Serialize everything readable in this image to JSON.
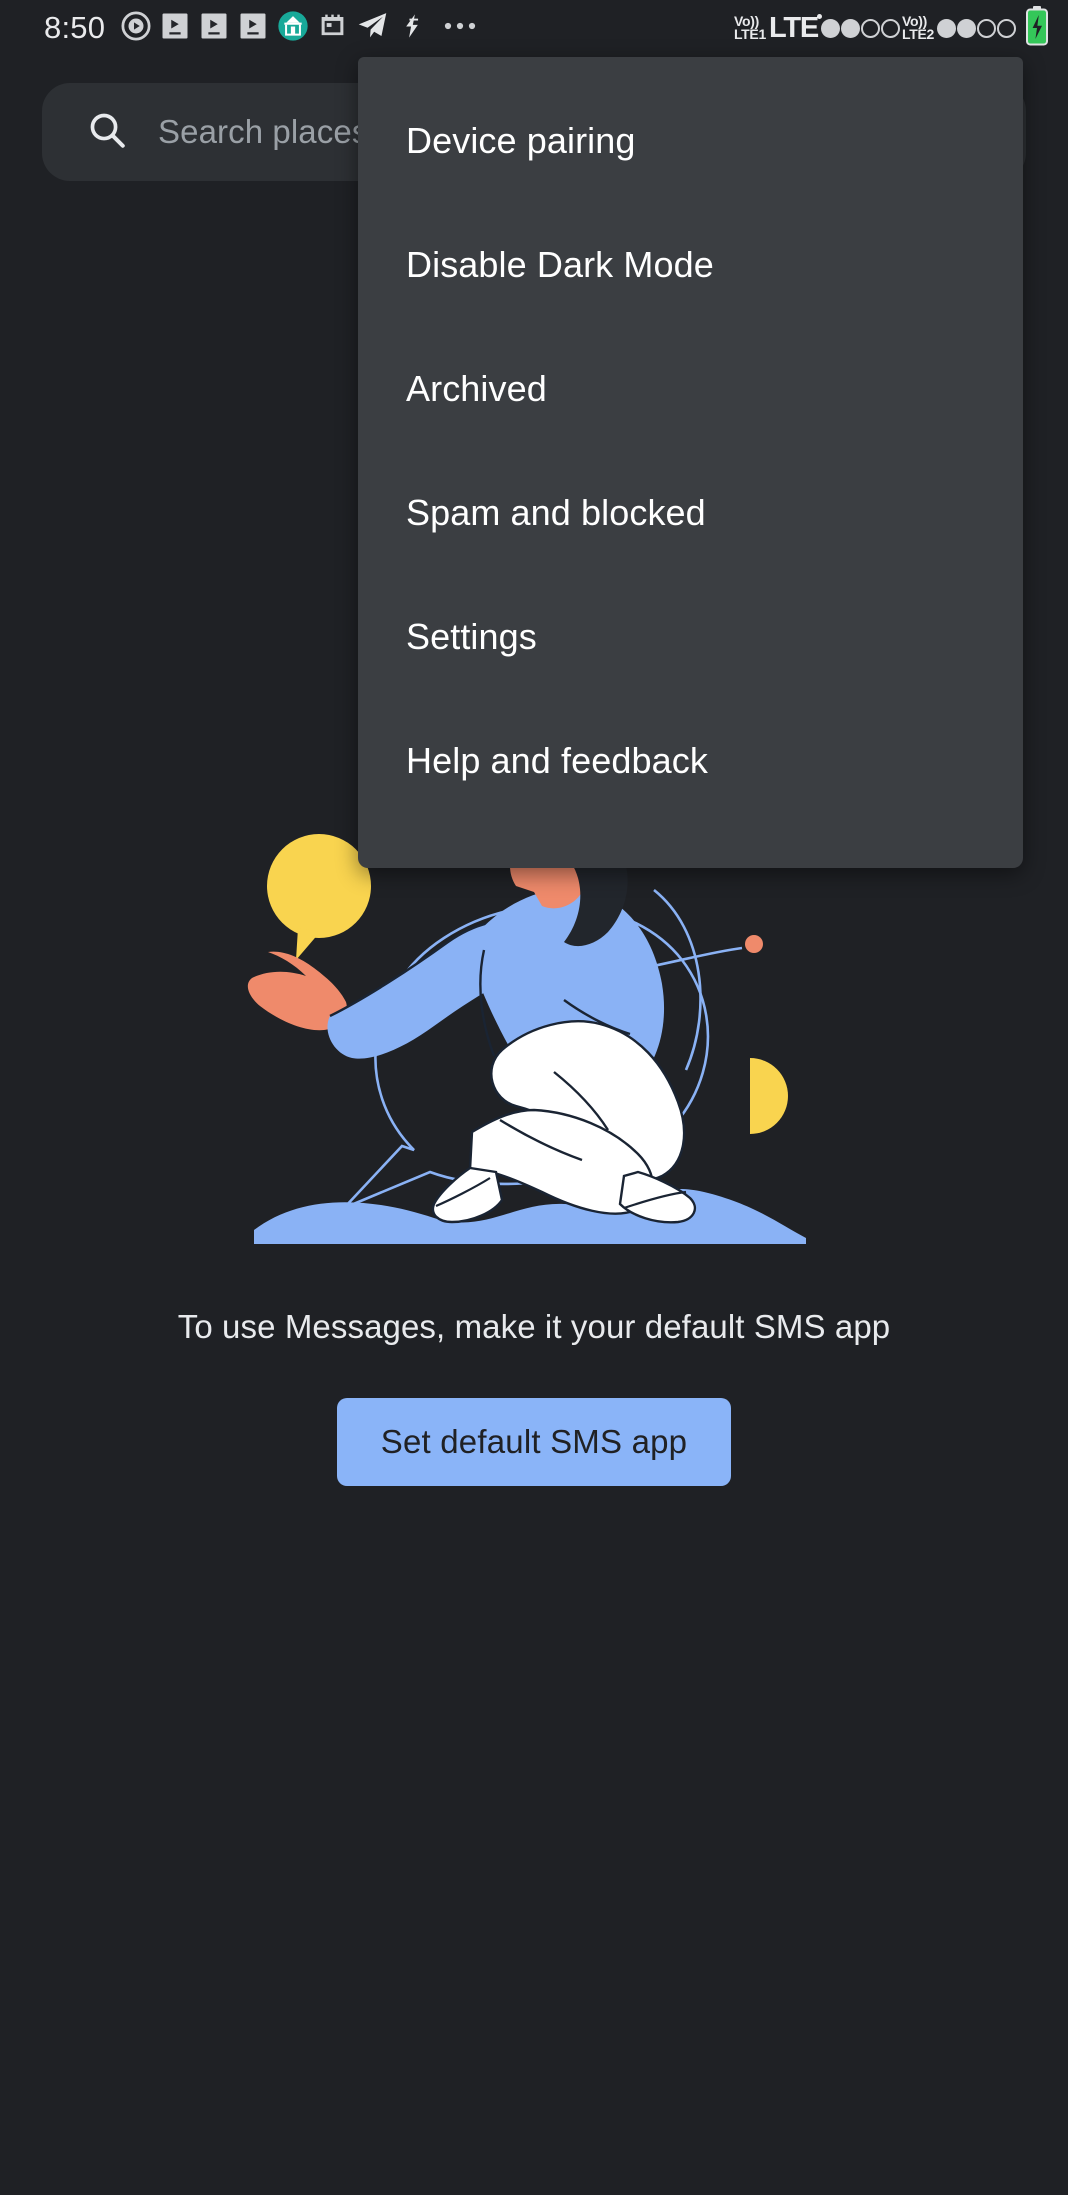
{
  "status_bar": {
    "time": "8:50",
    "left_icons": [
      {
        "name": "media-play-circle-icon",
        "glyph": "play-circle"
      },
      {
        "name": "video-notification-icon-1",
        "glyph": "video-box"
      },
      {
        "name": "video-notification-icon-2",
        "glyph": "video-box"
      },
      {
        "name": "video-notification-icon-3",
        "glyph": "video-box"
      },
      {
        "name": "store-icon",
        "glyph": "store"
      },
      {
        "name": "calendar-icon",
        "glyph": "calendar"
      },
      {
        "name": "telegram-icon",
        "glyph": "telegram"
      },
      {
        "name": "flash-icon",
        "glyph": "flash"
      },
      {
        "name": "more-notifications-icon",
        "glyph": "ellipsis"
      }
    ],
    "sim1": {
      "volte_label_top": "Vo))",
      "volte_label_bottom": "LTE1",
      "network_label": "LTE",
      "bars_filled": 2,
      "bars_empty": 2
    },
    "sim2": {
      "volte_label_top": "Vo))",
      "volte_label_bottom": "LTE2",
      "bars_filled": 2,
      "bars_empty": 2
    },
    "battery": {
      "name": "battery-charging-icon",
      "color": "#34c759"
    }
  },
  "search": {
    "placeholder": "Search places",
    "icon": "search-icon"
  },
  "overflow_menu": {
    "items": [
      {
        "label": "Device pairing"
      },
      {
        "label": "Disable Dark Mode"
      },
      {
        "label": "Archived"
      },
      {
        "label": "Spam and blocked"
      },
      {
        "label": "Settings"
      },
      {
        "label": "Help and feedback"
      }
    ]
  },
  "empty_state": {
    "illustration_name": "person-sitting-illustration",
    "title": "To use Messages, make it your default SMS app",
    "button_label": "Set default SMS app",
    "button_color": "#8ab4f8",
    "button_text_color": "#202124"
  },
  "theme": {
    "background": "#1f2125",
    "search_background": "#2d3034",
    "menu_background": "#3b3e42",
    "accent": "#8ab4f8",
    "illustration_blue": "#8ab2f5",
    "illustration_yellow": "#f9d44f",
    "illustration_coral": "#ef8a6b",
    "illustration_white": "#ffffff"
  }
}
